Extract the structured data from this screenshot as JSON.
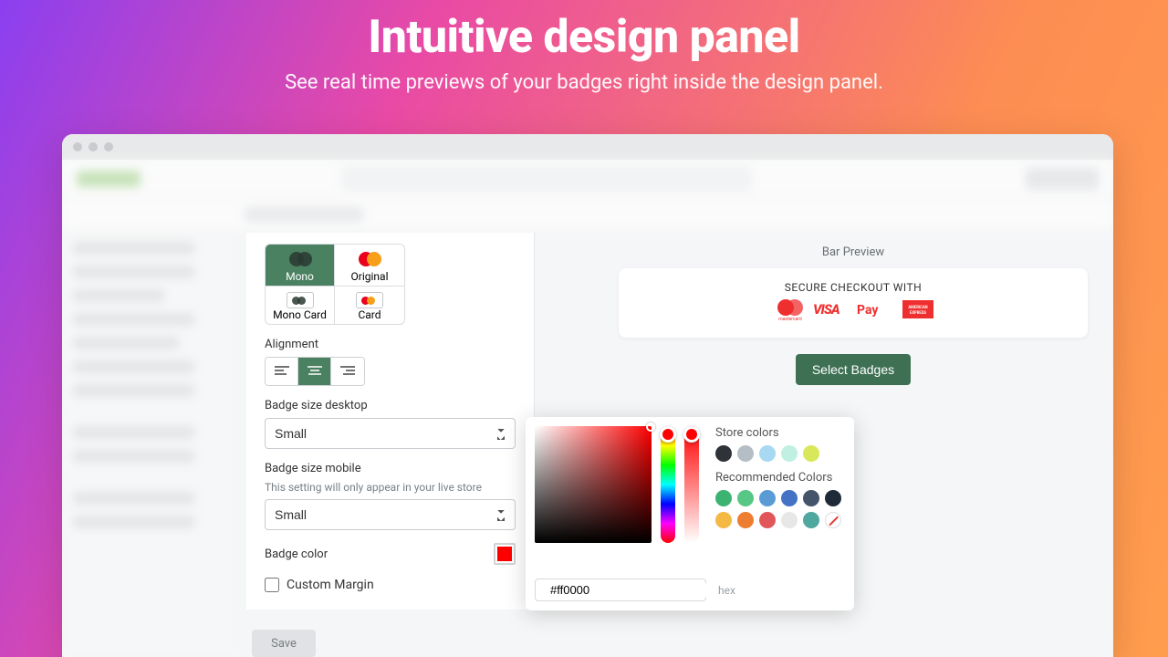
{
  "hero": {
    "title": "Intuitive design panel",
    "subtitle": "See real time previews of your badges right inside the design panel."
  },
  "panel": {
    "styles": [
      "Mono",
      "Original",
      "Mono Card",
      "Card"
    ],
    "alignment_label": "Alignment",
    "size_desktop_label": "Badge size desktop",
    "size_desktop_value": "Small",
    "size_mobile_label": "Badge size mobile",
    "size_mobile_hint": "This setting will only appear in your live store",
    "size_mobile_value": "Small",
    "badge_color_label": "Badge color",
    "badge_color": "#ff0000",
    "custom_margin_label": "Custom Margin"
  },
  "preview": {
    "label": "Bar Preview",
    "secure_text": "SECURE CHECKOUT WITH",
    "select_badges": "Select Badges"
  },
  "picker": {
    "store_colors_label": "Store colors",
    "store_colors": [
      "#2f3337",
      "#b6bec5",
      "#a7d9f2",
      "#bff0e1",
      "#d9e85a"
    ],
    "recommended_label": "Recommended Colors",
    "recommended_colors": [
      "#3cb371",
      "#57c785",
      "#5b9bd5",
      "#4472c4",
      "#44546a",
      "#1f2a38",
      "#f4b942",
      "#ed7d31",
      "#e15759",
      "#e7e7e7",
      "#4ea8a0"
    ],
    "hex_value": "#ff0000",
    "hex_suffix": "hex"
  },
  "save_label": "Save"
}
